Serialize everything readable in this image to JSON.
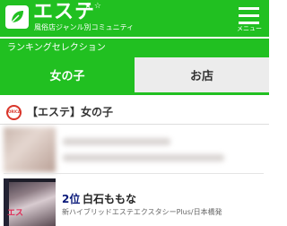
{
  "header": {
    "app_title": "エステ",
    "title_stars": "★ ☆",
    "tagline": "風俗店ジャンル別コミュニティ",
    "menu_label": "メニュー",
    "accent_color": "#21c021",
    "logo_icon": "leaf-icon",
    "menu_icon": "hamburger-icon"
  },
  "ranking_section": {
    "label": "ランキングセレクション"
  },
  "tabs": [
    {
      "label": "女の子",
      "active": true
    },
    {
      "label": "お店",
      "active": false
    }
  ],
  "section": {
    "title": "【エステ】女の子",
    "logo_icon": "shop-logo-icon"
  },
  "ranked_items": [
    {
      "rank": "2位",
      "name": "白石ももな",
      "shop": "新ハイブリッドエステエクスタシーPlus/日本橋発",
      "photo_overlay": "エス"
    }
  ]
}
